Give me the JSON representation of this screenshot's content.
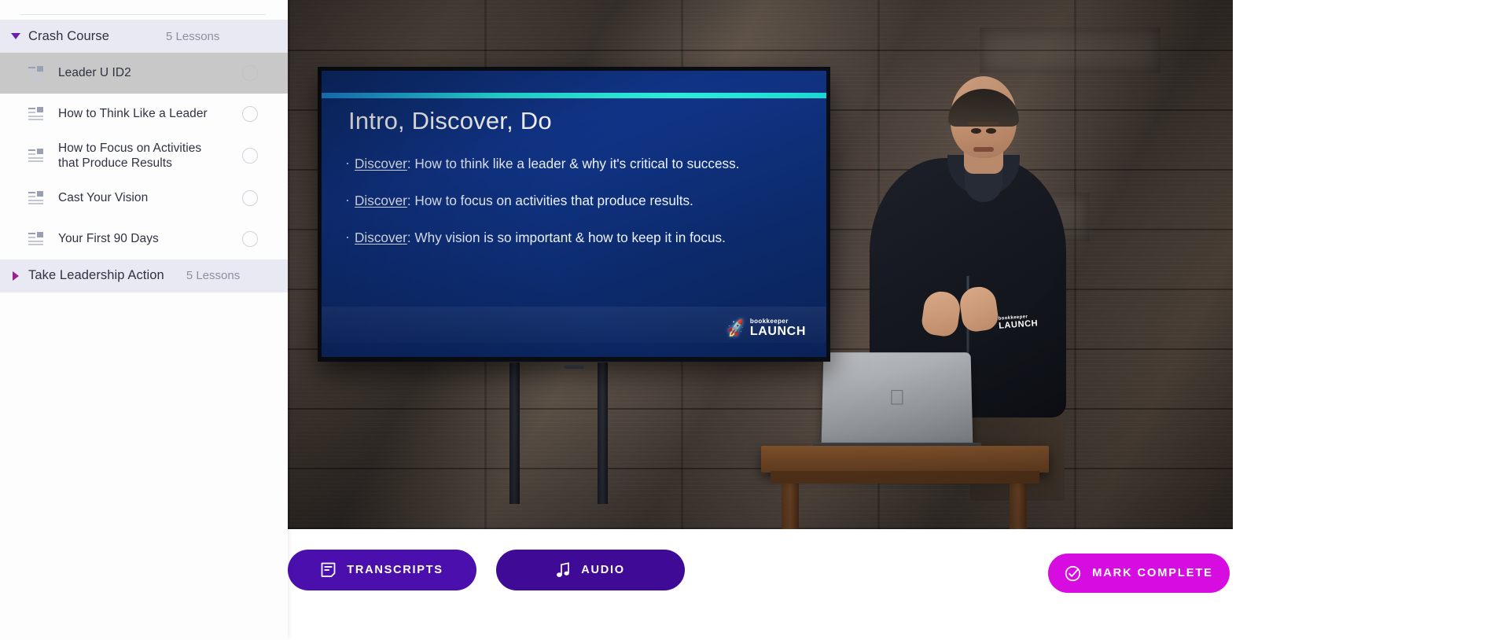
{
  "sidebar": {
    "sections": [
      {
        "title": "Crash Course",
        "lessons_count": "5 Lessons",
        "expanded": true,
        "lessons": [
          {
            "label": "Leader U ID2",
            "active": true,
            "status": "incomplete"
          },
          {
            "label": "How to Think Like a Leader",
            "active": false,
            "status": "incomplete"
          },
          {
            "label": "How to Focus on Activities that Produce Results",
            "active": false,
            "status": "incomplete"
          },
          {
            "label": "Cast Your Vision",
            "active": false,
            "status": "incomplete"
          },
          {
            "label": "Your First 90 Days",
            "active": false,
            "status": "incomplete"
          }
        ]
      },
      {
        "title": "Take Leadership Action",
        "lessons_count": "5 Lessons",
        "expanded": false,
        "lessons": []
      }
    ]
  },
  "video": {
    "slide": {
      "title": "Intro, Discover, Do",
      "bullets": [
        {
          "lead": "Discover",
          "rest": ": How to think like a leader & why it's critical to success."
        },
        {
          "lead": "Discover",
          "rest": ": How to focus on activities that produce results."
        },
        {
          "lead": "Discover",
          "rest": ": Why vision is so important & how to keep it in focus."
        }
      ],
      "logo_small": "bookkeeper",
      "logo_big": "LAUNCH",
      "rocket_icon": "rocket-icon"
    },
    "presenter": {
      "hoodie_logo_small": "bookkeeper",
      "hoodie_logo_big": "LAUNCH",
      "laptop_brand_icon": "apple-logo-icon"
    }
  },
  "actions": {
    "transcripts": {
      "label": "TRANSCRIPTS",
      "icon": "transcript-document-icon",
      "color": "#4a0fad"
    },
    "audio": {
      "label": "AUDIO",
      "icon": "music-note-icon",
      "color": "#3f0b96"
    },
    "mark_complete": {
      "label": "MARK COMPLETE",
      "icon": "check-circle-icon",
      "color": "#d70ce0"
    }
  },
  "colors": {
    "sidebar_bg": "#fdfdfd",
    "section_header_bg": "#e9e9f3",
    "active_lesson_bg": "#c8c8c8",
    "accent_purple": "#4a0fad",
    "accent_magenta": "#d70ce0",
    "caret_expanded": "#6b1fb0",
    "caret_collapsed": "#9c1f8f"
  }
}
